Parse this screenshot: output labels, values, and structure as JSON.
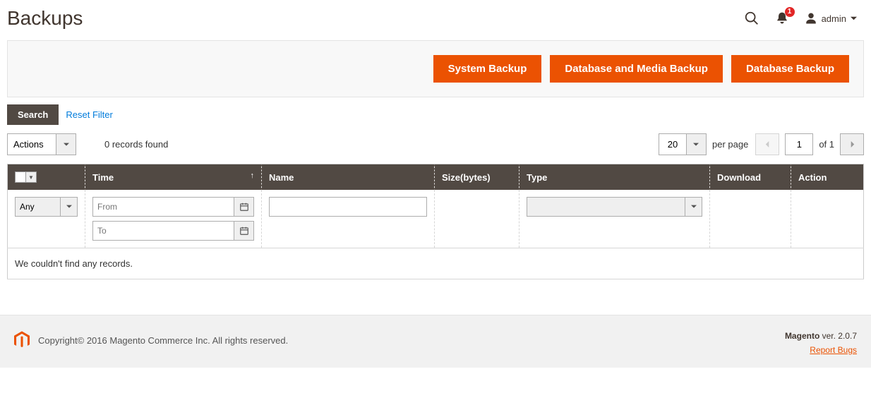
{
  "header": {
    "title": "Backups",
    "notif_count": "1",
    "admin_label": "admin"
  },
  "actions": {
    "system_backup": "System Backup",
    "db_media_backup": "Database and Media Backup",
    "db_backup": "Database Backup"
  },
  "grid": {
    "search_btn": "Search",
    "reset_filter": "Reset Filter",
    "actions_label": "Actions",
    "records_found": "0 records found",
    "per_page_value": "20",
    "per_page_label": "per page",
    "current_page": "1",
    "total_pages_label": "of 1",
    "columns": {
      "time": "Time",
      "name": "Name",
      "size": "Size(bytes)",
      "type": "Type",
      "download": "Download",
      "action": "Action"
    },
    "filters": {
      "any_option": "Any",
      "from_placeholder": "From",
      "to_placeholder": "To",
      "name_value": "",
      "type_value": ""
    },
    "empty_text": "We couldn't find any records."
  },
  "footer": {
    "copyright": "Copyright© 2016 Magento Commerce Inc. All rights reserved.",
    "product": "Magento",
    "version_prefix": " ver. ",
    "version": "2.0.7",
    "report_bugs": "Report Bugs"
  }
}
